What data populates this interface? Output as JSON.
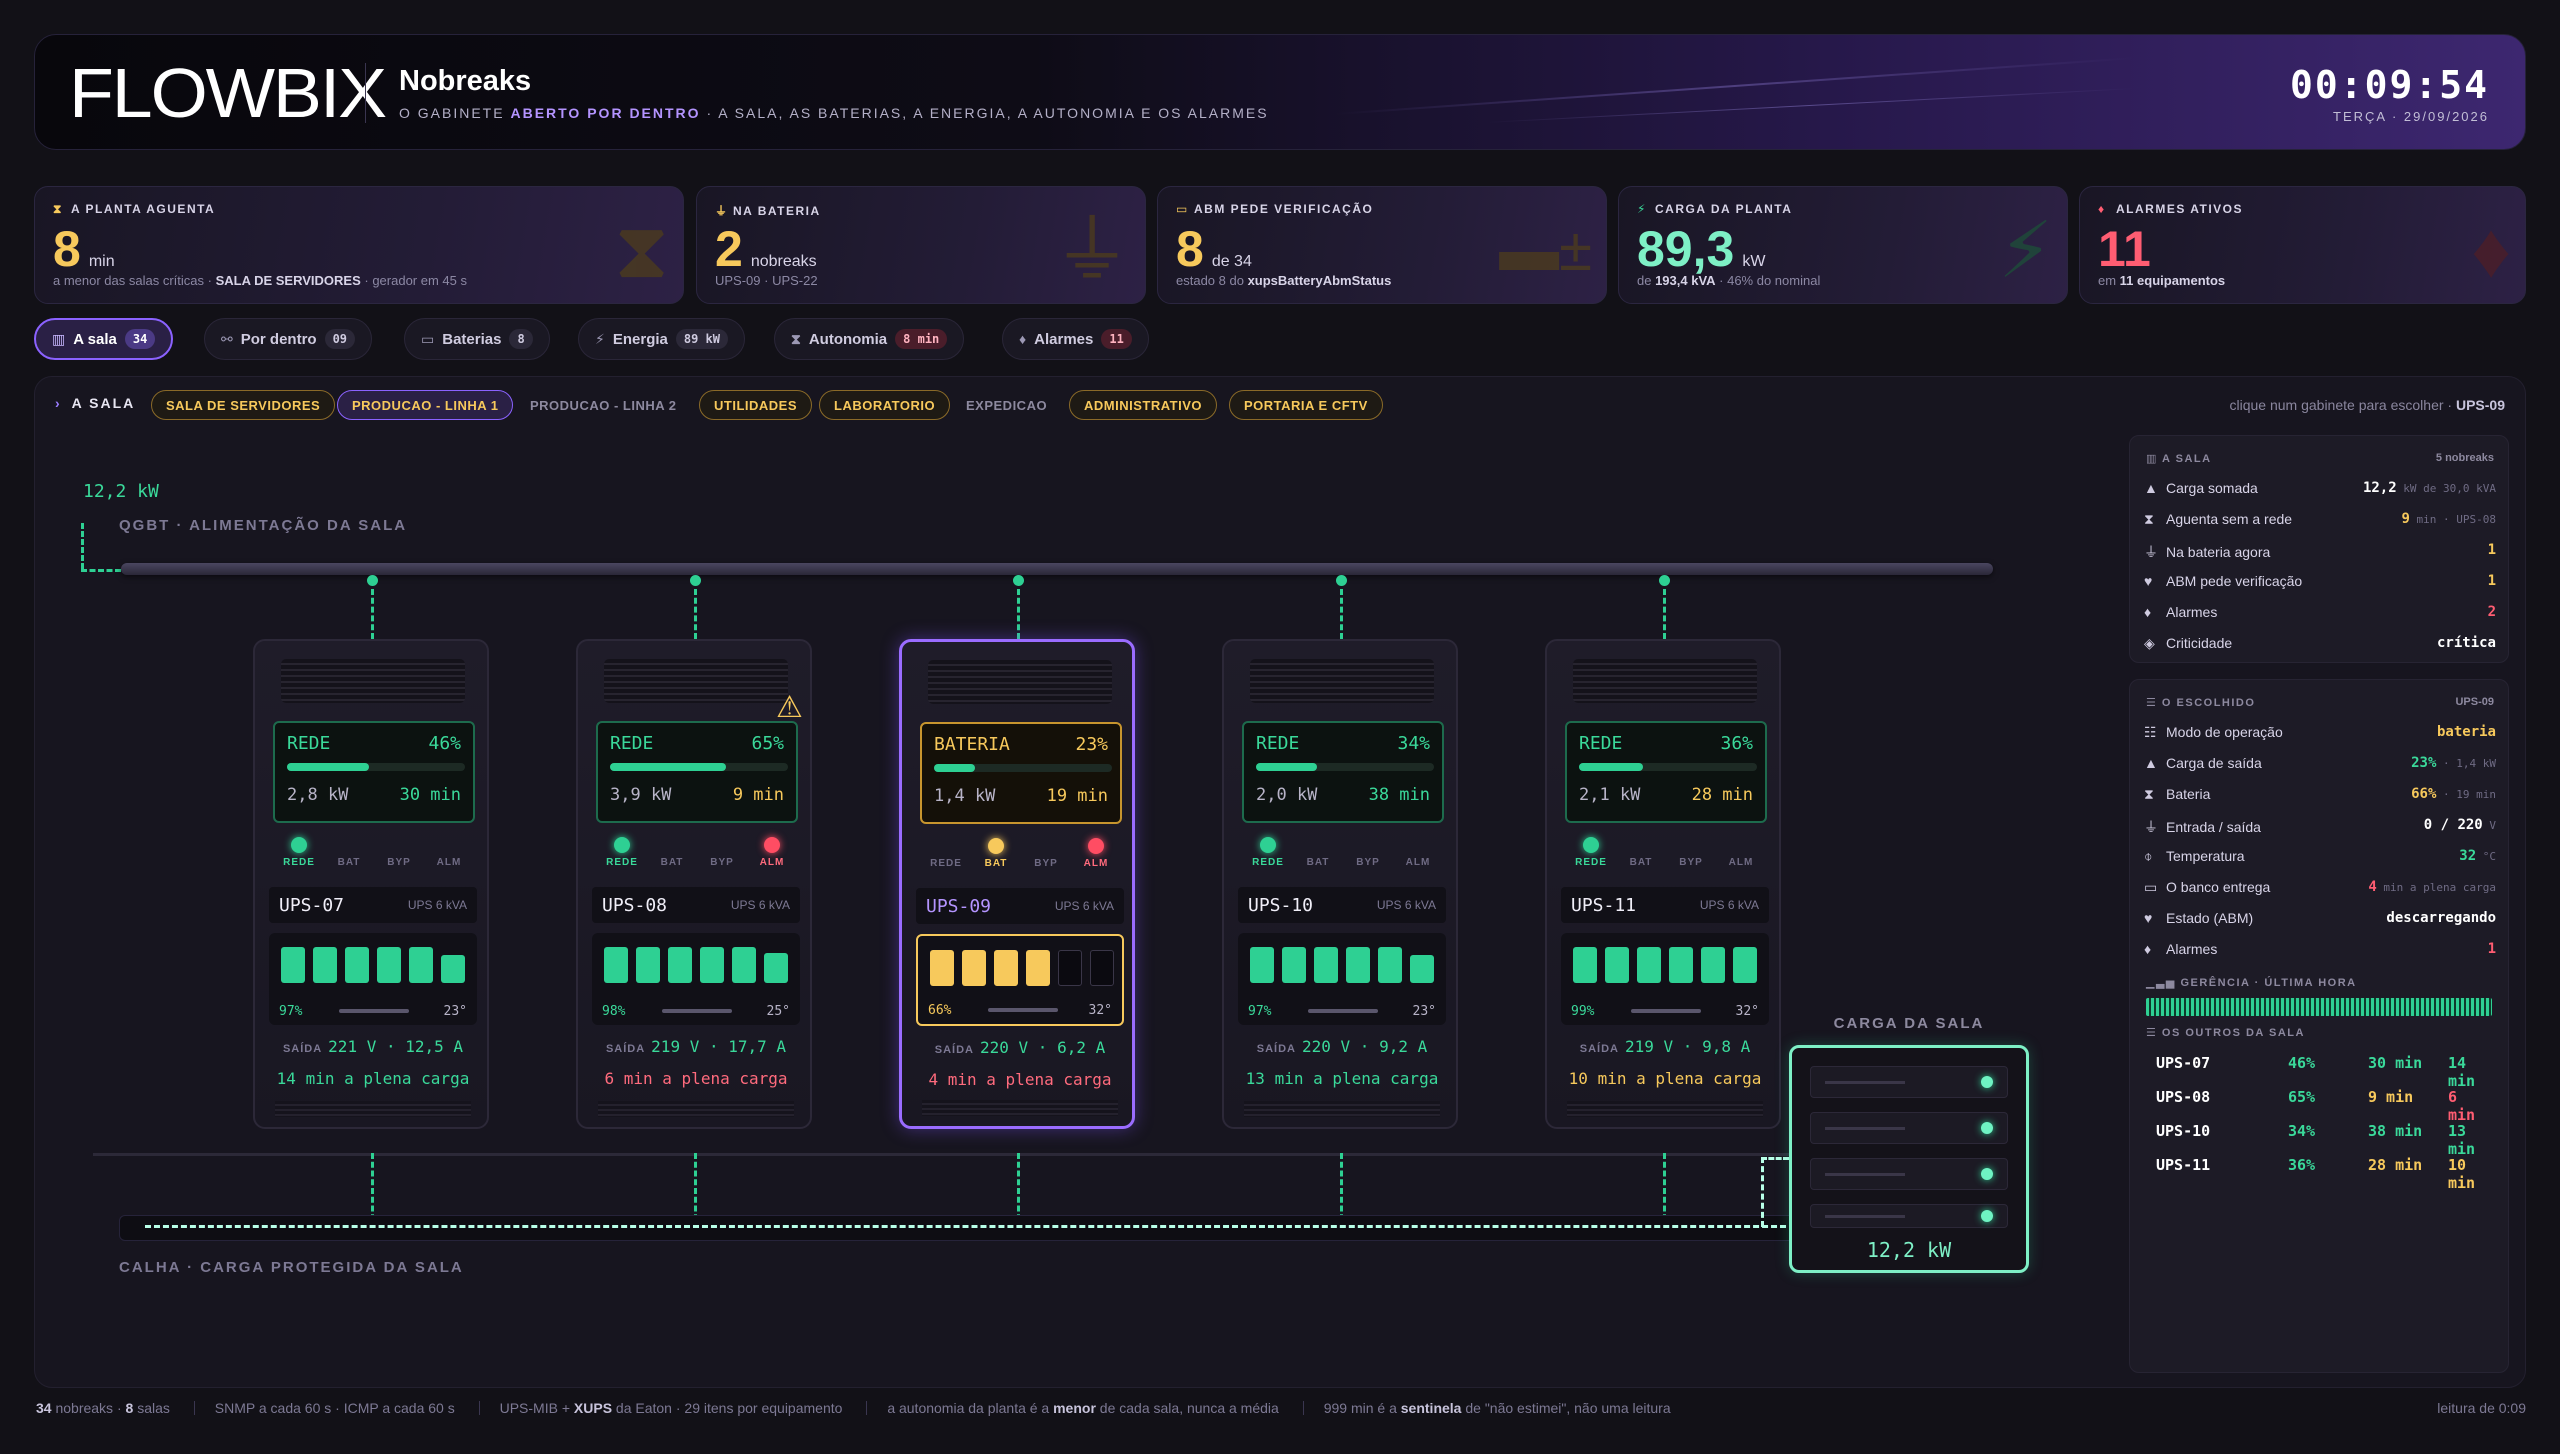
{
  "header": {
    "logo": "FLOWBIX",
    "title": "Nobreaks",
    "subtitle_pre": "O GABINETE ",
    "subtitle_accent": "ABERTO POR DENTRO",
    "subtitle_post": " · A SALA, AS BATERIAS, A ENERGIA, A AUTONOMIA E OS ALARMES",
    "clock": "00:09:54",
    "date": "TERÇA · 29/09/2026"
  },
  "kpis": [
    {
      "label": "A PLANTA AGUENTA",
      "icon": "hourglass-icon",
      "value": "8",
      "unit": "min",
      "sub_pre": "a menor das salas críticas · ",
      "sub_bold": "SALA DE SERVIDORES",
      "sub_post": " · gerador em 45 s",
      "color": "#f7c95c"
    },
    {
      "label": "NA BATERIA",
      "icon": "plug-icon",
      "value": "2",
      "unit": "nobreaks",
      "sub_pre": "UPS-09 · UPS-22",
      "sub_bold": "",
      "sub_post": "",
      "color": "#f7c95c"
    },
    {
      "label": "ABM PEDE VERIFICAÇÃO",
      "icon": "battery-icon",
      "value": "8",
      "unit": "de 34",
      "sub_pre": "estado 8 do ",
      "sub_bold": "xupsBatteryAbmStatus",
      "sub_post": "",
      "color": "#f7c95c"
    },
    {
      "label": "CARGA DA PLANTA",
      "icon": "bolt-icon",
      "value": "89,3",
      "unit": "kW",
      "sub_pre": "de ",
      "sub_bold": "193,4 kVA",
      "sub_post": " · 46% do nominal",
      "color": "#3ad99a"
    },
    {
      "label": "ALARMES ATIVOS",
      "icon": "bell-icon",
      "value": "11",
      "unit": "",
      "sub_pre": "em ",
      "sub_bold": "11 equipamentos",
      "sub_post": "",
      "color": "#ff5d72"
    }
  ],
  "tabs": [
    {
      "label": "A sala",
      "count": "34",
      "icon": "building-icon"
    },
    {
      "label": "Por dentro",
      "count": "09",
      "icon": "network-icon"
    },
    {
      "label": "Baterias",
      "count": "8",
      "icon": "battery-icon"
    },
    {
      "label": "Energia",
      "count": "89 kW",
      "icon": "bolt-icon"
    },
    {
      "label": "Autonomia",
      "count": "8 min",
      "icon": "hourglass-icon"
    },
    {
      "label": "Alarmes",
      "count": "11",
      "icon": "bell-icon"
    }
  ],
  "room": {
    "crumb": "A SALA",
    "chips": [
      "SALA DE SERVIDORES",
      "PRODUCAO - LINHA 1",
      "PRODUCAO - LINHA 2",
      "UTILIDADES",
      "LABORATORIO",
      "EXPEDICAO",
      "ADMINISTRATIVO",
      "PORTARIA E CFTV"
    ],
    "hint_pre": "clique num gabinete para escolher · ",
    "hint_sel": "UPS-09",
    "input_kw": "12,2 kW",
    "qgbt_label": "QGBT · ALIMENTAÇÃO DA SALA",
    "calha_label": "CALHA · CARGA PROTEGIDA DA SALA",
    "load_title": "CARGA DA SALA",
    "load_kw": "12,2 kW"
  },
  "leds": [
    "REDE",
    "BAT",
    "BYP",
    "ALM"
  ],
  "ups": [
    {
      "name": "UPS-07",
      "model": "UPS 6 kVA",
      "mode": "REDE",
      "load_pct": "46%",
      "load": 0.46,
      "kw": "2,8 kW",
      "runtime": "30 min",
      "batt_pct": "97%",
      "batt_cells": 6,
      "temp": "23°",
      "out_v": "221 V",
      "out_a": "12,5 A",
      "full_load": "14 min a plena carga",
      "out_label": "SAÍDA"
    },
    {
      "name": "UPS-08",
      "model": "UPS 6 kVA",
      "mode": "REDE",
      "load_pct": "65%",
      "load": 0.65,
      "kw": "3,9 kW",
      "runtime": "9 min",
      "batt_pct": "98%",
      "batt_cells": 6,
      "temp": "25°",
      "out_v": "219 V",
      "out_a": "17,7 A",
      "full_load": "6 min a plena carga",
      "out_label": "SAÍDA"
    },
    {
      "name": "UPS-09",
      "model": "UPS 6 kVA",
      "mode": "BATERIA",
      "load_pct": "23%",
      "load": 0.23,
      "kw": "1,4 kW",
      "runtime": "19 min",
      "batt_pct": "66%",
      "batt_cells": 4,
      "temp": "32°",
      "out_v": "220 V",
      "out_a": "6,2 A",
      "full_load": "4 min a plena carga",
      "out_label": "SAÍDA"
    },
    {
      "name": "UPS-10",
      "model": "UPS 6 kVA",
      "mode": "REDE",
      "load_pct": "34%",
      "load": 0.34,
      "kw": "2,0 kW",
      "runtime": "38 min",
      "batt_pct": "97%",
      "batt_cells": 6,
      "temp": "23°",
      "out_v": "220 V",
      "out_a": "9,2 A",
      "full_load": "13 min a plena carga",
      "out_label": "SAÍDA"
    },
    {
      "name": "UPS-11",
      "model": "UPS 6 kVA",
      "mode": "REDE",
      "load_pct": "36%",
      "load": 0.36,
      "kw": "2,1 kW",
      "runtime": "28 min",
      "batt_pct": "99%",
      "batt_cells": 6,
      "temp": "32°",
      "out_v": "219 V",
      "out_a": "9,8 A",
      "full_load": "10 min a plena carga",
      "out_label": "SAÍDA"
    }
  ],
  "sala": {
    "title": "A SALA",
    "count": "5 nobreaks",
    "rows": [
      {
        "label": "Carga somada",
        "icon": "load-icon",
        "value": "12,2",
        "small": " kW de 30,0 kVA"
      },
      {
        "label": "Aguenta sem a rede",
        "icon": "hourglass-icon",
        "value": "9",
        "small": " min · UPS-08"
      },
      {
        "label": "Na bateria agora",
        "icon": "plug-icon",
        "value": "1",
        "small": ""
      },
      {
        "label": "ABM pede verificação",
        "icon": "heart-icon",
        "value": "1",
        "small": ""
      },
      {
        "label": "Alarmes",
        "icon": "bell-icon",
        "value": "2",
        "small": ""
      },
      {
        "label": "Criticidade",
        "icon": "shield-icon",
        "value": "crítica",
        "small": ""
      }
    ]
  },
  "escolhido": {
    "title": "O ESCOLHIDO",
    "name": "UPS-09",
    "rows": [
      {
        "label": "Modo de operação",
        "icon": "list-icon",
        "value": "bateria",
        "small": ""
      },
      {
        "label": "Carga de saída",
        "icon": "load-icon",
        "value": "23%",
        "small": " · 1,4 kW"
      },
      {
        "label": "Bateria",
        "icon": "hourglass-icon",
        "value": "66%",
        "small": " · 19 min"
      },
      {
        "label": "Entrada / saída",
        "icon": "plug-icon",
        "value": "0 / 220",
        "small": " V"
      },
      {
        "label": "Temperatura",
        "icon": "thermometer-icon",
        "value": "32",
        "small": " °C"
      },
      {
        "label": "O banco entrega",
        "icon": "battery-icon",
        "value": "4",
        "small": " min a plena carga"
      },
      {
        "label": "Estado (ABM)",
        "icon": "heart-icon",
        "value": "descarregando",
        "small": ""
      },
      {
        "label": "Alarmes",
        "icon": "bell-icon",
        "value": "1",
        "small": ""
      }
    ],
    "spark_title": "GERÊNCIA · ÚLTIMA HORA",
    "others_title": "OS OUTROS DA SALA"
  },
  "others": [
    [
      "UPS-07",
      "46%",
      "30 min",
      "14 min"
    ],
    [
      "UPS-08",
      "65%",
      "9 min",
      "6 min"
    ],
    [
      "UPS-10",
      "34%",
      "38 min",
      "13 min"
    ],
    [
      "UPS-11",
      "36%",
      "28 min",
      "10 min"
    ]
  ],
  "status": {
    "s1_b1": "34",
    "s1_t1": " nobreaks · ",
    "s1_b2": "8",
    "s1_t2": " salas",
    "s2": "SNMP a cada 60 s · ICMP a cada 60 s",
    "s3_t1": "UPS-MIB + ",
    "s3_b": "XUPS",
    "s3_t2": " da Eaton · 29 itens por equipamento",
    "s4_t1": "a autonomia da planta é a ",
    "s4_b": "menor",
    "s4_t2": " de cada sala, nunca a média",
    "s5_t1": "999 min é a ",
    "s5_b": "sentinela",
    "s5_t2": " de \"não estimei\", não uma leitura",
    "right": "leitura de 0:09"
  },
  "colors": {
    "accent": "#8b62ff",
    "green": "#3ad99a",
    "yellow": "#f7c95c",
    "red": "#ff5d72"
  }
}
